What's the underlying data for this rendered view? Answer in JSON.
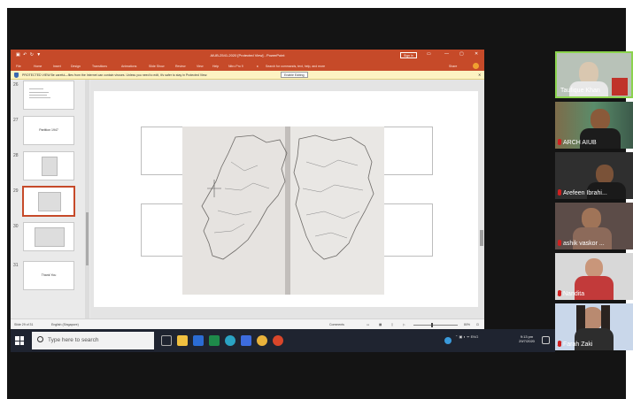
{
  "ppt": {
    "quick_access": "▣ ↶ ↻ ▼",
    "doc_title": "AIUB-2541-2020 [Protected View] - PowerPoint",
    "sign_in": "Sign in",
    "window_controls": [
      "▭",
      "—",
      "▢",
      "✕"
    ],
    "menu_tabs": [
      "File",
      "Home",
      "Insert",
      "Design",
      "Transitions",
      "Animations",
      "Slide Show",
      "Review",
      "View",
      "Help",
      "Nitro Pro 9"
    ],
    "tell_me": "Search for commands, text, help, and more",
    "share": "Share",
    "protected_text": "PROTECTED VIEW  Be careful—files from the Internet can contain viruses. Unless you need to edit, it's safer to stay in Protected View.",
    "enable_editing": "Enable Editing",
    "close_bar": "✕"
  },
  "thumbnails": [
    {
      "num": "26",
      "label": ""
    },
    {
      "num": "27",
      "label": "Partition 1947"
    },
    {
      "num": "28",
      "label": ""
    },
    {
      "num": "29",
      "label": ""
    },
    {
      "num": "30",
      "label": ""
    },
    {
      "num": "31",
      "label": "Thank You"
    }
  ],
  "statusbar": {
    "slide_info": "Slide 29 of 31",
    "language": "English (Singapore)",
    "comments": "Comments",
    "zoom": "80%"
  },
  "taskbar": {
    "search_placeholder": "Type here to search",
    "tray_icons": "⌃ ▣ ◖ ᯤ ENG",
    "time": "9:13 pm",
    "date": "29/7/2020"
  },
  "participants": [
    {
      "name": "Taufique Khan",
      "speaking": true
    },
    {
      "name": "ARCH AIUB",
      "speaking": false
    },
    {
      "name": "Arefeen Ibrahi...",
      "speaking": false
    },
    {
      "name": "ashik vaskor ...",
      "speaking": false
    },
    {
      "name": "Nandita",
      "speaking": false
    },
    {
      "name": "Farah Zaki",
      "speaking": false
    }
  ]
}
